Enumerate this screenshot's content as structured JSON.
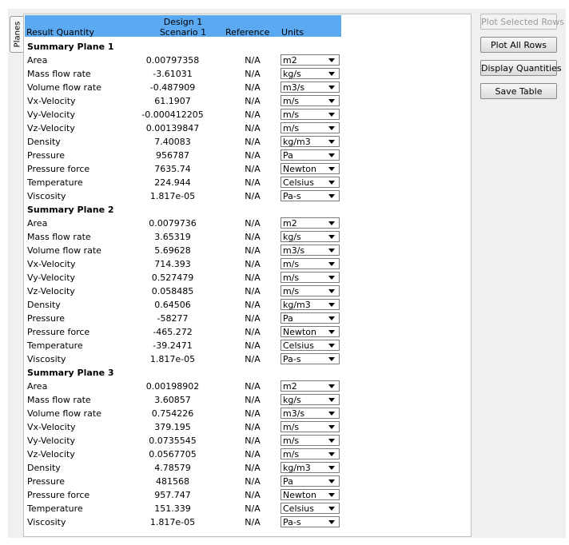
{
  "tab": {
    "label": "Planes"
  },
  "header": {
    "quantity": "Result Quantity",
    "design": "Design 1",
    "scenario": "Scenario 1",
    "reference": "Reference",
    "units": "Units"
  },
  "buttons": {
    "plot_selected": "Plot Selected Rows",
    "plot_all": "Plot All Rows",
    "display_quantities": "Display Quantities",
    "save_table": "Save Table"
  },
  "sections": [
    {
      "title": "Summary Plane 1",
      "rows": [
        {
          "name": "Area",
          "value": "0.00797358",
          "ref": "N/A",
          "unit": "m2"
        },
        {
          "name": "Mass flow rate",
          "value": "-3.61031",
          "ref": "N/A",
          "unit": "kg/s"
        },
        {
          "name": "Volume flow rate",
          "value": "-0.487909",
          "ref": "N/A",
          "unit": "m3/s"
        },
        {
          "name": "Vx-Velocity",
          "value": "61.1907",
          "ref": "N/A",
          "unit": "m/s"
        },
        {
          "name": "Vy-Velocity",
          "value": "-0.000412205",
          "ref": "N/A",
          "unit": "m/s"
        },
        {
          "name": "Vz-Velocity",
          "value": "0.00139847",
          "ref": "N/A",
          "unit": "m/s"
        },
        {
          "name": "Density",
          "value": "7.40083",
          "ref": "N/A",
          "unit": "kg/m3"
        },
        {
          "name": "Pressure",
          "value": "956787",
          "ref": "N/A",
          "unit": "Pa"
        },
        {
          "name": "Pressure force",
          "value": "7635.74",
          "ref": "N/A",
          "unit": "Newton"
        },
        {
          "name": "Temperature",
          "value": "224.944",
          "ref": "N/A",
          "unit": "Celsius"
        },
        {
          "name": "Viscosity",
          "value": "1.817e-05",
          "ref": "N/A",
          "unit": "Pa-s"
        }
      ]
    },
    {
      "title": "Summary Plane 2",
      "rows": [
        {
          "name": "Area",
          "value": "0.0079736",
          "ref": "N/A",
          "unit": "m2"
        },
        {
          "name": "Mass flow rate",
          "value": "3.65319",
          "ref": "N/A",
          "unit": "kg/s"
        },
        {
          "name": "Volume flow rate",
          "value": "5.69628",
          "ref": "N/A",
          "unit": "m3/s"
        },
        {
          "name": "Vx-Velocity",
          "value": "714.393",
          "ref": "N/A",
          "unit": "m/s"
        },
        {
          "name": "Vy-Velocity",
          "value": "0.527479",
          "ref": "N/A",
          "unit": "m/s"
        },
        {
          "name": "Vz-Velocity",
          "value": "0.058485",
          "ref": "N/A",
          "unit": "m/s"
        },
        {
          "name": "Density",
          "value": "0.64506",
          "ref": "N/A",
          "unit": "kg/m3"
        },
        {
          "name": "Pressure",
          "value": "-58277",
          "ref": "N/A",
          "unit": "Pa"
        },
        {
          "name": "Pressure force",
          "value": "-465.272",
          "ref": "N/A",
          "unit": "Newton"
        },
        {
          "name": "Temperature",
          "value": "-39.2471",
          "ref": "N/A",
          "unit": "Celsius"
        },
        {
          "name": "Viscosity",
          "value": "1.817e-05",
          "ref": "N/A",
          "unit": "Pa-s"
        }
      ]
    },
    {
      "title": "Summary Plane 3",
      "rows": [
        {
          "name": "Area",
          "value": "0.00198902",
          "ref": "N/A",
          "unit": "m2"
        },
        {
          "name": "Mass flow rate",
          "value": "3.60857",
          "ref": "N/A",
          "unit": "kg/s"
        },
        {
          "name": "Volume flow rate",
          "value": "0.754226",
          "ref": "N/A",
          "unit": "m3/s"
        },
        {
          "name": "Vx-Velocity",
          "value": "379.195",
          "ref": "N/A",
          "unit": "m/s"
        },
        {
          "name": "Vy-Velocity",
          "value": "0.0735545",
          "ref": "N/A",
          "unit": "m/s"
        },
        {
          "name": "Vz-Velocity",
          "value": "0.0567705",
          "ref": "N/A",
          "unit": "m/s"
        },
        {
          "name": "Density",
          "value": "4.78579",
          "ref": "N/A",
          "unit": "kg/m3"
        },
        {
          "name": "Pressure",
          "value": "481568",
          "ref": "N/A",
          "unit": "Pa"
        },
        {
          "name": "Pressure force",
          "value": "957.747",
          "ref": "N/A",
          "unit": "Newton"
        },
        {
          "name": "Temperature",
          "value": "151.339",
          "ref": "N/A",
          "unit": "Celsius"
        },
        {
          "name": "Viscosity",
          "value": "1.817e-05",
          "ref": "N/A",
          "unit": "Pa-s"
        }
      ]
    }
  ]
}
